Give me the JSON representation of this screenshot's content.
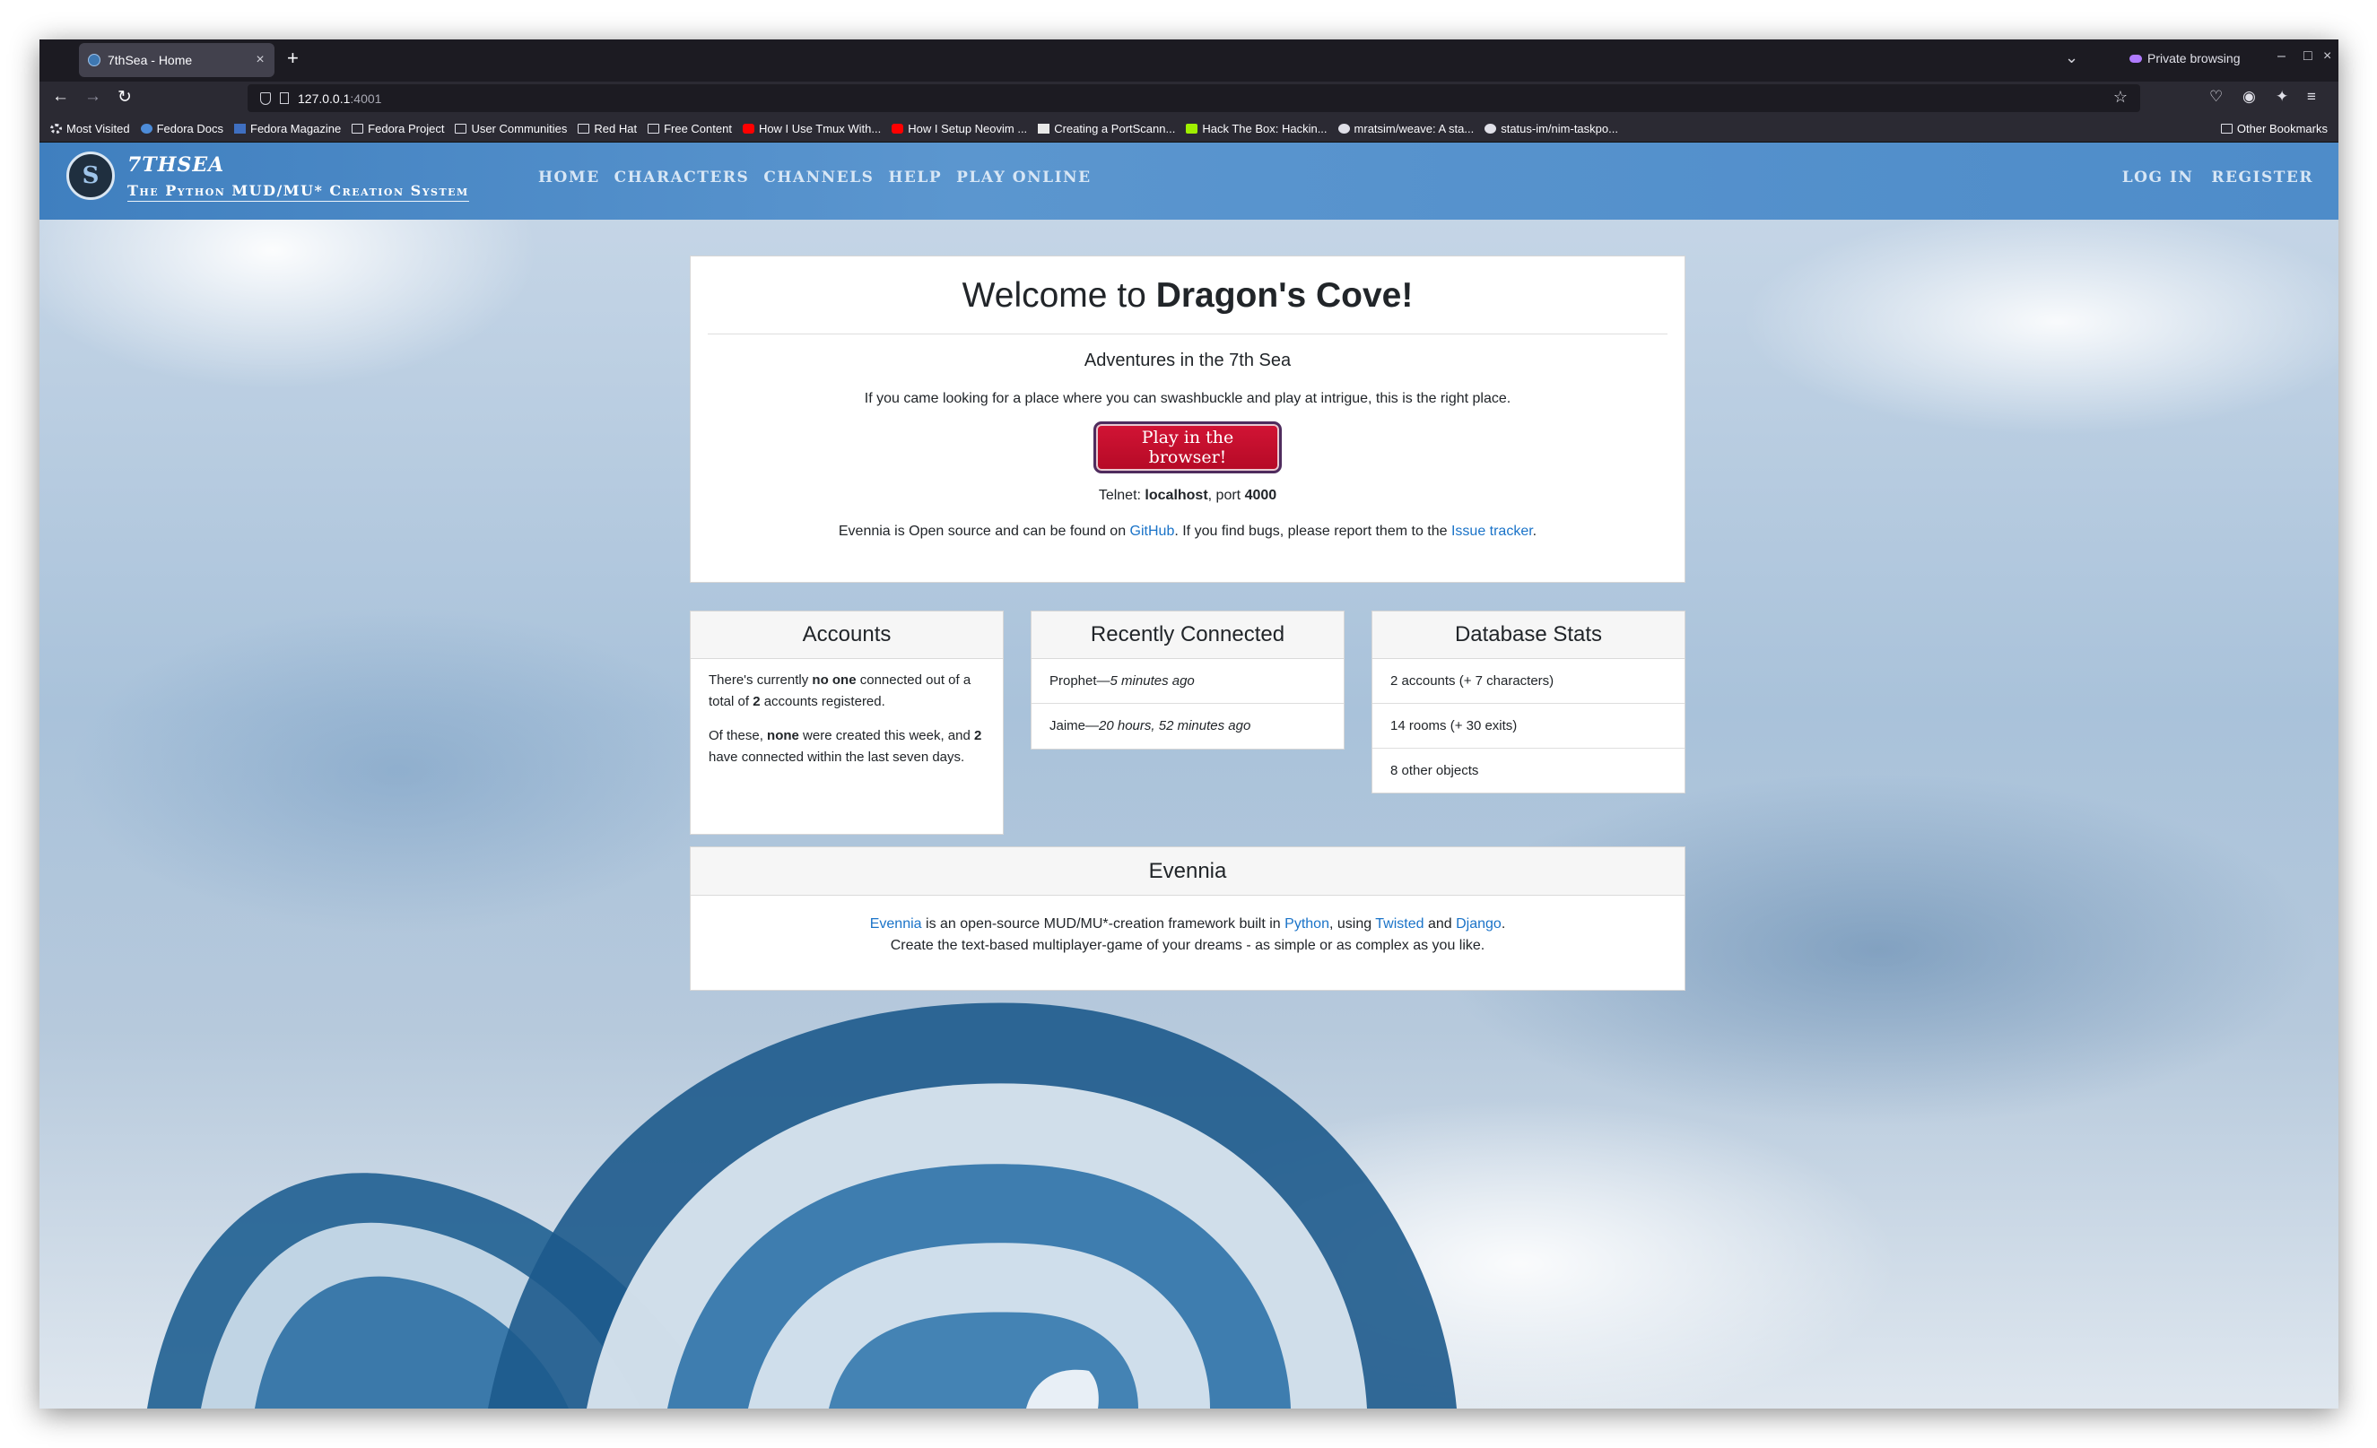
{
  "browser": {
    "tab_title": "7thSea - Home",
    "private_label": "Private browsing",
    "url_host": "127.0.0.1",
    "url_port": ":4001",
    "bookmarks": [
      {
        "label": "Most Visited",
        "icon": "gear-icon"
      },
      {
        "label": "Fedora Docs",
        "icon": "fedora-icon"
      },
      {
        "label": "Fedora Magazine",
        "icon": "magazine-icon"
      },
      {
        "label": "Fedora Project",
        "icon": "folder-icon"
      },
      {
        "label": "User Communities",
        "icon": "folder-icon"
      },
      {
        "label": "Red Hat",
        "icon": "folder-icon"
      },
      {
        "label": "Free Content",
        "icon": "folder-icon"
      },
      {
        "label": "How I Use Tmux With...",
        "icon": "youtube-icon"
      },
      {
        "label": "How I Setup Neovim ...",
        "icon": "youtube-icon"
      },
      {
        "label": "Creating a PortScann...",
        "icon": "site-icon"
      },
      {
        "label": "Hack The Box: Hackin...",
        "icon": "htb-icon"
      },
      {
        "label": "mratsim/weave: A sta...",
        "icon": "github-icon"
      },
      {
        "label": "status-im/nim-taskpo...",
        "icon": "github-icon"
      }
    ],
    "other_bookmarks": "Other Bookmarks"
  },
  "site": {
    "brand": "7THSEA",
    "tagline": "The Python MUD/MU* Creation System",
    "nav": [
      "Home",
      "Characters",
      "Channels",
      "Help",
      "Play Online"
    ],
    "auth": [
      "Log In",
      "Register"
    ]
  },
  "hero": {
    "title_prefix": "Welcome to ",
    "title_name": "Dragon's Cove!",
    "subtitle": "Adventures in the 7th Sea",
    "lead": "If you came looking for a place where you can swashbuckle and play at intrigue, this is the right place.",
    "play_button": "Play in the browser!",
    "telnet_label": "Telnet: ",
    "telnet_host": "localhost",
    "telnet_mid": ", port ",
    "telnet_port": "4000",
    "source_pre": "Evennia is Open source and can be found on ",
    "github_link": "GitHub",
    "source_mid": ". If you find bugs, please report them to the ",
    "tracker_link": "Issue tracker",
    "source_end": "."
  },
  "accounts": {
    "title": "Accounts",
    "p1_a": "There's currently ",
    "p1_b": "no one",
    "p1_c": " connected out of a total of ",
    "p1_d": "2",
    "p1_e": " accounts registered.",
    "p2_a": "Of these, ",
    "p2_b": "none",
    "p2_c": " were created this week, and ",
    "p2_d": "2",
    "p2_e": " have connected within the last seven days."
  },
  "recent": {
    "title": "Recently Connected",
    "rows": [
      {
        "name": "Prophet",
        "sep": "—",
        "time": "5 minutes ago"
      },
      {
        "name": "Jaime",
        "sep": "—",
        "time": "20 hours, 52 minutes ago"
      }
    ]
  },
  "dbstats": {
    "title": "Database Stats",
    "rows": [
      "2 accounts (+ 7 characters)",
      "14 rooms (+ 30 exits)",
      "8 other objects"
    ]
  },
  "evennia": {
    "title": "Evennia",
    "l1_link": "Evennia",
    "l1_a": " is an open-source MUD/MU*-creation framework built in ",
    "python": "Python",
    "l1_b": ", using ",
    "twisted": "Twisted",
    "l1_c": " and ",
    "django": "Django",
    "l1_d": ".",
    "line2": "Create the text-based multiplayer-game of your dreams - as simple or as complex as you like."
  },
  "colors": {
    "header": "#4e8cc9",
    "button": "#c5102e",
    "link": "#1a73c8"
  }
}
